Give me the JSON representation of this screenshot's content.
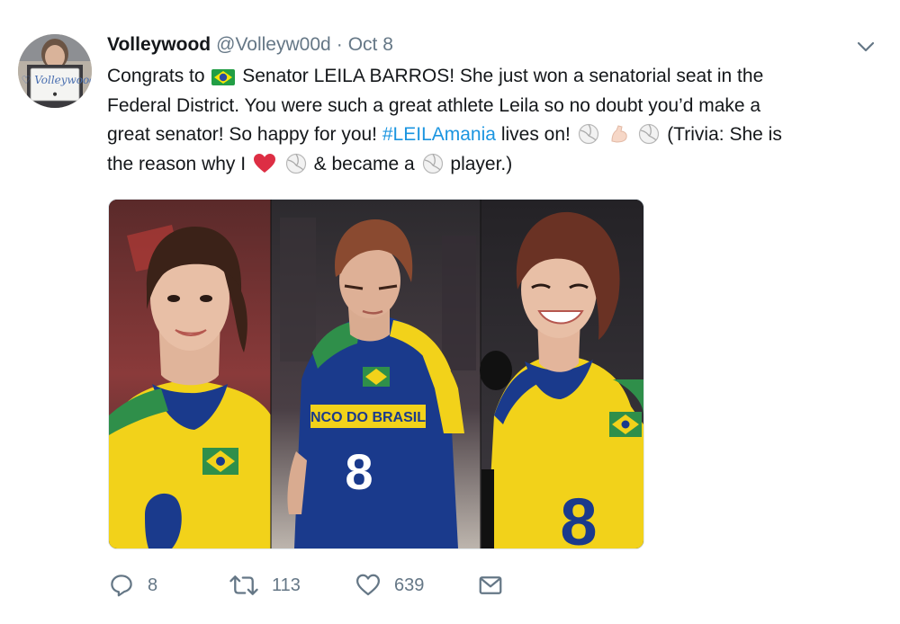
{
  "tweet": {
    "author": {
      "name": "Volleywood",
      "handle": "@Volleyw00d",
      "avatar_sign_text": "I ♡ Volleywood"
    },
    "separator": "·",
    "date": "Oct 8",
    "text": {
      "l1_a": "Congrats to",
      "l1_b": "Senator LEILA BARROS! She just won a senatorial seat in the",
      "l2": "Federal District. You were such a great athlete Leila so no doubt you’d make a",
      "l3_a": "great senator! So happy for you!",
      "hashtag": "#LEILAmania",
      "l3_b": "lives on!",
      "l3_c": "(Trivia: She is",
      "l4_a": "the reason why I",
      "l4_b": "& became a",
      "l4_c": "player.)"
    },
    "emojis": [
      "brazil-flag",
      "volleyball",
      "flexed-biceps",
      "volleyball",
      "red-heart",
      "volleyball",
      "volleyball"
    ],
    "media": {
      "jersey_text": "NCO DO BRASIL",
      "jersey_number": "8"
    },
    "actions": {
      "replies": "8",
      "retweets": "113",
      "likes": "639"
    }
  },
  "colors": {
    "text": "#14171a",
    "secondary": "#657786",
    "link": "#1b95e0",
    "heart": "#e0245e",
    "jersey_yellow": "#f2d21a",
    "jersey_blue": "#1a3a8c",
    "jersey_green": "#2f8f4a"
  }
}
